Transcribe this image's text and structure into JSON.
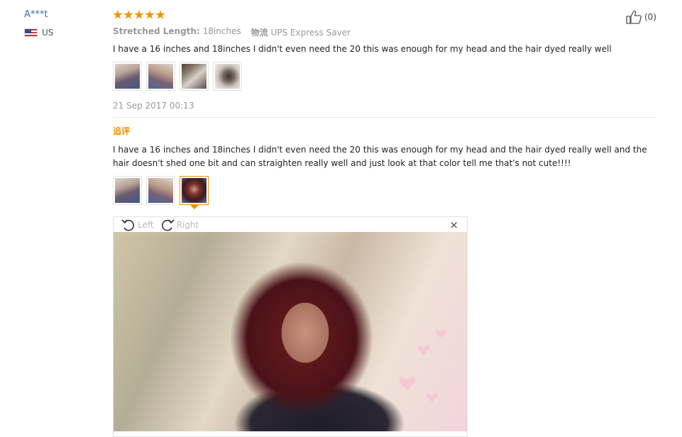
{
  "reviewer": {
    "name": "A***t",
    "country": "US"
  },
  "rating": {
    "stars": 5,
    "max": 5
  },
  "attributes": [
    {
      "key": "Stretched Length:",
      "value": "18inches"
    },
    {
      "key": "物流",
      "value": "UPS Express Saver"
    }
  ],
  "review": {
    "text": "I have a 16 inches and 18inches I didn't even need the 20 this was enough for my head and the hair dyed really well",
    "date": "21 Sep 2017 00:13"
  },
  "like": {
    "count_label": "(0)"
  },
  "followup": {
    "title": "追评",
    "text": "I have a 16 inches and 18inches I didn't even need the 20 this was enough for my head and the hair dyed really well and the hair doesn't shed one bit and can straighten really well and just look at that color tell me that's not cute!!!!"
  },
  "viewer": {
    "rotate_left_label": "Left",
    "rotate_right_label": "Right",
    "close_label": "×"
  },
  "colors": {
    "accent": "#f29100",
    "link": "#2f6fb5",
    "muted": "#999999"
  }
}
